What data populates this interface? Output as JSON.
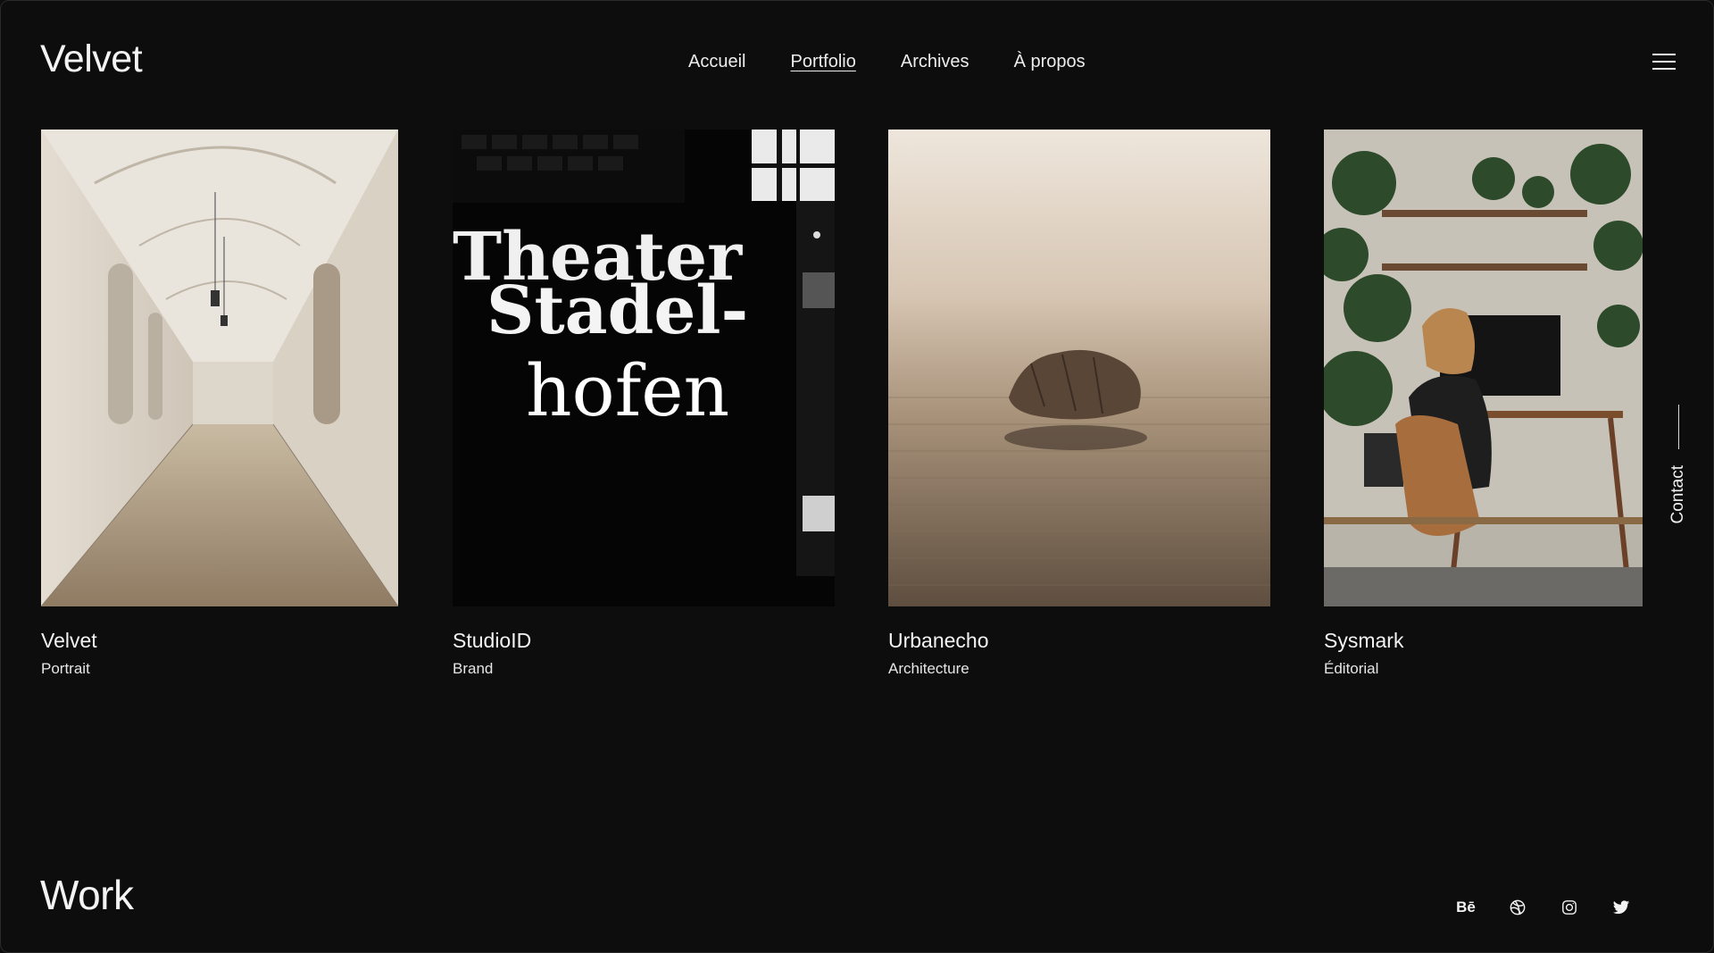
{
  "brand": {
    "logo": "Velvet"
  },
  "nav": {
    "items": [
      {
        "label": "Accueil",
        "active": false
      },
      {
        "label": "Portfolio",
        "active": true
      },
      {
        "label": "Archives",
        "active": false
      },
      {
        "label": "À propos",
        "active": false
      }
    ]
  },
  "menu": {
    "icon": "hamburger-icon"
  },
  "projects": [
    {
      "title": "Velvet",
      "category": "Portrait",
      "image": "arched-corridor-photo"
    },
    {
      "title": "StudioID",
      "category": "Brand",
      "image": "theater-poster-photo",
      "poster_text": [
        "Theater",
        "Stadel-",
        "hofen"
      ]
    },
    {
      "title": "Urbanecho",
      "category": "Architecture",
      "image": "rock-in-sea-photo"
    },
    {
      "title": "Sysmark",
      "category": "Éditorial",
      "image": "home-office-photo"
    }
  ],
  "contact": {
    "label": "Contact"
  },
  "section": {
    "title": "Work"
  },
  "social": [
    {
      "name": "behance-icon",
      "glyph": "Bē"
    },
    {
      "name": "dribbble-icon"
    },
    {
      "name": "instagram-icon"
    },
    {
      "name": "twitter-icon"
    }
  ],
  "colors": {
    "background": "#0d0d0d",
    "text": "#f2f2f2"
  }
}
